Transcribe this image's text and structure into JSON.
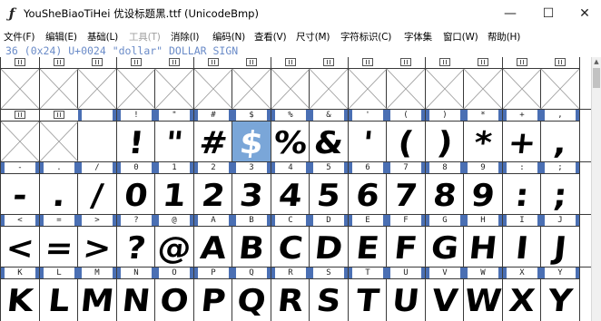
{
  "window": {
    "title": "YouSheBiaoTiHei  优设标题黑.ttf (UnicodeBmp)",
    "icon": "fontforge-quill-icon",
    "buttons": {
      "minimize": "—",
      "maximize": "☐",
      "close": "✕"
    }
  },
  "menu": [
    {
      "label": "文件(F)",
      "enabled": true
    },
    {
      "label": "编辑(E)",
      "enabled": true
    },
    {
      "label": "基础(L)",
      "enabled": true
    },
    {
      "label": "工具(T)",
      "enabled": false
    },
    {
      "label": "消除(I)",
      "enabled": true
    },
    {
      "label": "编码(N)",
      "enabled": true
    },
    {
      "label": "查看(V)",
      "enabled": true
    },
    {
      "label": "尺寸(M)",
      "enabled": true
    },
    {
      "label": "字符标识(C)",
      "enabled": true
    },
    {
      "label": "字体集",
      "enabled": true
    },
    {
      "label": "窗口(W)",
      "enabled": true
    },
    {
      "label": "帮助(H)",
      "enabled": true
    }
  ],
  "status": {
    "text": "36 (0x24) U+0024 \"dollar\" DOLLAR SIGN"
  },
  "colors": {
    "selection": "#7aa6d8",
    "label_mark": "#4a6fb3",
    "status_text": "#6a8bc8",
    "grid_line": "#3a3a3a"
  },
  "glyph_grid": {
    "columns": 15,
    "selected_char": "$",
    "rows": [
      {
        "cells": [
          {
            "label": "",
            "glyph": "",
            "empty": true
          },
          {
            "label": "",
            "glyph": "",
            "empty": true
          },
          {
            "label": "",
            "glyph": "",
            "empty": true
          },
          {
            "label": "",
            "glyph": "",
            "empty": true
          },
          {
            "label": "",
            "glyph": "",
            "empty": true
          },
          {
            "label": "",
            "glyph": "",
            "empty": true
          },
          {
            "label": "",
            "glyph": "",
            "empty": true
          },
          {
            "label": "",
            "glyph": "",
            "empty": true
          },
          {
            "label": "",
            "glyph": "",
            "empty": true
          },
          {
            "label": "",
            "glyph": "",
            "empty": true
          },
          {
            "label": "",
            "glyph": "",
            "empty": true
          },
          {
            "label": "",
            "glyph": "",
            "empty": true
          },
          {
            "label": "",
            "glyph": "",
            "empty": true
          },
          {
            "label": "",
            "glyph": "",
            "empty": true
          },
          {
            "label": "",
            "glyph": "",
            "empty": true
          }
        ]
      },
      {
        "cells": [
          {
            "label": "",
            "glyph": "",
            "empty": true
          },
          {
            "label": "",
            "glyph": "",
            "empty": true
          },
          {
            "label": "",
            "glyph": "",
            "empty": false,
            "glyph_space": true
          },
          {
            "label": "!",
            "glyph": "!"
          },
          {
            "label": "\"",
            "glyph": "\""
          },
          {
            "label": "#",
            "glyph": "#"
          },
          {
            "label": "$",
            "glyph": "$",
            "selected": true
          },
          {
            "label": "%",
            "glyph": "%"
          },
          {
            "label": "&",
            "glyph": "&"
          },
          {
            "label": "'",
            "glyph": "'"
          },
          {
            "label": "(",
            "glyph": "("
          },
          {
            "label": ")",
            "glyph": ")"
          },
          {
            "label": "*",
            "glyph": "*"
          },
          {
            "label": "+",
            "glyph": "+"
          },
          {
            "label": ",",
            "glyph": ","
          }
        ]
      },
      {
        "cells": [
          {
            "label": "-",
            "glyph": "-"
          },
          {
            "label": ".",
            "glyph": "."
          },
          {
            "label": "/",
            "glyph": "/"
          },
          {
            "label": "0",
            "glyph": "0"
          },
          {
            "label": "1",
            "glyph": "1"
          },
          {
            "label": "2",
            "glyph": "2"
          },
          {
            "label": "3",
            "glyph": "3"
          },
          {
            "label": "4",
            "glyph": "4"
          },
          {
            "label": "5",
            "glyph": "5"
          },
          {
            "label": "6",
            "glyph": "6"
          },
          {
            "label": "7",
            "glyph": "7"
          },
          {
            "label": "8",
            "glyph": "8"
          },
          {
            "label": "9",
            "glyph": "9"
          },
          {
            "label": ":",
            "glyph": ":"
          },
          {
            "label": ";",
            "glyph": ";"
          }
        ]
      },
      {
        "cells": [
          {
            "label": "<",
            "glyph": "<"
          },
          {
            "label": "=",
            "glyph": "="
          },
          {
            "label": ">",
            "glyph": ">"
          },
          {
            "label": "?",
            "glyph": "?"
          },
          {
            "label": "@",
            "glyph": "@"
          },
          {
            "label": "A",
            "glyph": "A"
          },
          {
            "label": "B",
            "glyph": "B"
          },
          {
            "label": "C",
            "glyph": "C"
          },
          {
            "label": "D",
            "glyph": "D"
          },
          {
            "label": "E",
            "glyph": "E"
          },
          {
            "label": "F",
            "glyph": "F"
          },
          {
            "label": "G",
            "glyph": "G"
          },
          {
            "label": "H",
            "glyph": "H"
          },
          {
            "label": "I",
            "glyph": "I"
          },
          {
            "label": "J",
            "glyph": "J"
          }
        ]
      },
      {
        "cells": [
          {
            "label": "K",
            "glyph": "K"
          },
          {
            "label": "L",
            "glyph": "L"
          },
          {
            "label": "M",
            "glyph": "M"
          },
          {
            "label": "N",
            "glyph": "N"
          },
          {
            "label": "O",
            "glyph": "O"
          },
          {
            "label": "P",
            "glyph": "P"
          },
          {
            "label": "Q",
            "glyph": "Q"
          },
          {
            "label": "R",
            "glyph": "R"
          },
          {
            "label": "S",
            "glyph": "S"
          },
          {
            "label": "T",
            "glyph": "T"
          },
          {
            "label": "U",
            "glyph": "U"
          },
          {
            "label": "V",
            "glyph": "V"
          },
          {
            "label": "W",
            "glyph": "W"
          },
          {
            "label": "X",
            "glyph": "X"
          },
          {
            "label": "Y",
            "glyph": "Y"
          }
        ]
      }
    ]
  },
  "scrollbar": {
    "up_arrow": "▲"
  }
}
